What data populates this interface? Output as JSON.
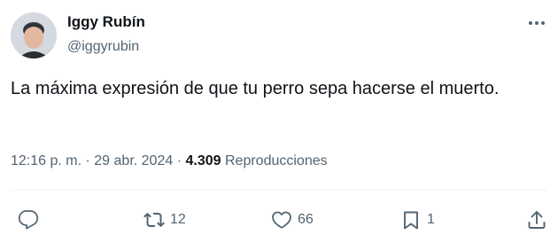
{
  "author": {
    "name": "Iggy Rubín",
    "handle": "@iggyrubin"
  },
  "tweet": {
    "text": "La máxima expresión de que tu perro sepa hacerse el muerto."
  },
  "meta": {
    "time": "12:16 p. m.",
    "separator": "·",
    "date": "29 abr. 2024",
    "views_count": "4.309",
    "views_label": "Reproducciones"
  },
  "actions": {
    "reply_count": "",
    "retweet_count": "12",
    "like_count": "66",
    "bookmark_count": "1"
  },
  "icons": {
    "more": "more-horizontal-icon",
    "reply": "reply-icon",
    "retweet": "retweet-icon",
    "like": "heart-icon",
    "bookmark": "bookmark-icon",
    "share": "share-icon"
  },
  "colors": {
    "text_primary": "#0f1419",
    "text_secondary": "#536471",
    "divider": "#eff3f4"
  }
}
